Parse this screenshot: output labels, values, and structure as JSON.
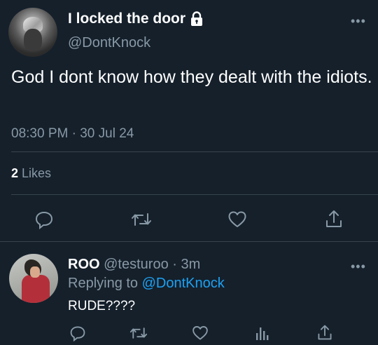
{
  "tweet": {
    "display_name": "I locked the door",
    "handle": "@DontKnock",
    "text": "God I dont know how they dealt with the idiots.",
    "time": "08:30 PM",
    "separator": "·",
    "date": "30 Jul 24",
    "likes_count": "2",
    "likes_label": "Likes",
    "more_label": "•••"
  },
  "reply": {
    "display_name": "ROO",
    "handle": "@testuroo",
    "separator": "·",
    "time": "3m",
    "replying_prefix": "Replying to",
    "replying_to": "@DontKnock",
    "text": "RUDE????",
    "more_label": "•••"
  },
  "icons": {
    "lock": "lock-icon",
    "reply": "reply-icon",
    "retweet": "retweet-icon",
    "like": "heart-icon",
    "share": "share-icon",
    "analytics": "analytics-icon"
  },
  "colors": {
    "background": "#15202b",
    "text": "#ffffff",
    "muted": "#8899a6",
    "accent": "#1da1f2",
    "divider": "#38444d"
  }
}
